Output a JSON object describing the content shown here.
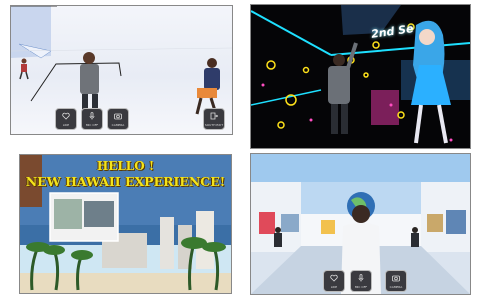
{
  "panel1": {
    "controls": [
      {
        "label": "LIKE",
        "icon": "heart-icon"
      },
      {
        "label": "MIC OFF",
        "icon": "mic-icon"
      },
      {
        "label": "CAMERA",
        "icon": "camera-icon"
      },
      {
        "label": "SOUTH EXIT",
        "icon": "exit-icon"
      }
    ]
  },
  "panel2": {
    "neon_sign": "2nd Se"
  },
  "panel3": {
    "title_line1": "HELLO !",
    "title_line2": "NEW HAWAII EXPERIENCE!"
  },
  "panel4": {
    "controls": [
      {
        "label": "LIKE",
        "icon": "heart-icon"
      },
      {
        "label": "MIC OFF",
        "icon": "mic-icon"
      },
      {
        "label": "CAMERA",
        "icon": "camera-icon"
      }
    ]
  },
  "colors": {
    "title_yellow": "#f4e41b",
    "neon_cyan": "#1ee0ff",
    "neon_yellow": "#ffe21a"
  }
}
